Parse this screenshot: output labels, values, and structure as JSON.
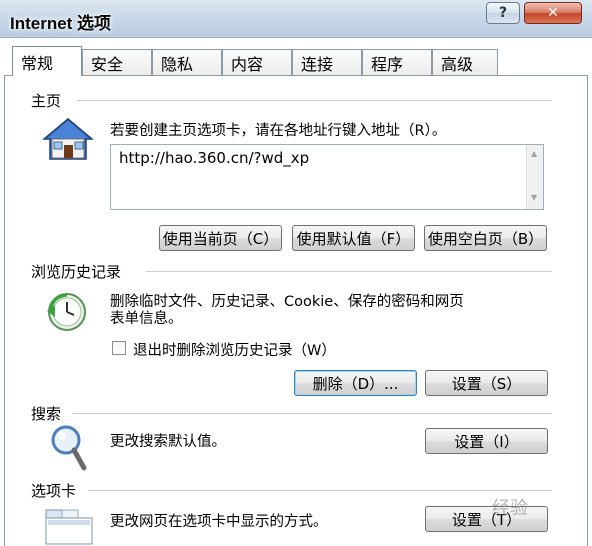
{
  "window": {
    "title": "Internet 选项",
    "help_label": "?",
    "close_label": "✕"
  },
  "tabs": [
    "常规",
    "安全",
    "隐私",
    "内容",
    "连接",
    "程序",
    "高级"
  ],
  "active_tab": "常规",
  "home": {
    "section": "主页",
    "description": "若要创建主页选项卡，请在各地址行键入地址（R）。",
    "url": "http://hao.360.cn/?wd_xp",
    "buttons": [
      "使用当前页（C）",
      "使用默认值（F）",
      "使用空白页（B）"
    ]
  },
  "history": {
    "section": "浏览历史记录",
    "description_line1": "删除临时文件、历史记录、Cookie、保存的密码和网页",
    "description_line2": "表单信息。",
    "checkbox_label": "退出时删除浏览历史记录（W）",
    "checked": false,
    "delete_button": "删除（D）...",
    "settings_button": "设置（S）"
  },
  "search": {
    "section": "搜索",
    "description": "更改搜索默认值。",
    "settings_button": "设置（I）"
  },
  "tabs_section": {
    "section": "选项卡",
    "description": "更改网页在选项卡中显示的方式。",
    "settings_button": "设置（T）"
  },
  "icons": {
    "home": "house-icon",
    "history": "clock-arrow-icon",
    "search": "magnifier-icon",
    "tabs": "tabbed-window-icon"
  },
  "watermark": "经验"
}
